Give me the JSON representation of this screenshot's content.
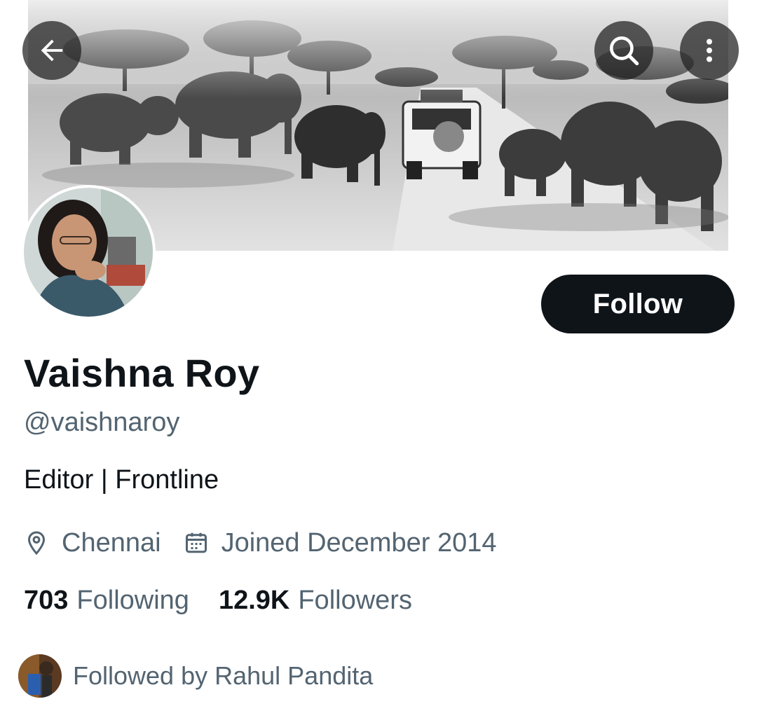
{
  "header": {
    "back_icon": "arrow-left-icon",
    "search_icon": "search-icon",
    "more_icon": "more-vertical-icon"
  },
  "profile": {
    "name": "Vaishna Roy",
    "handle": "@vaishnaroy",
    "bio": "Editor | Frontline",
    "location": "Chennai",
    "joined": "Joined December 2014",
    "follow_label": "Follow",
    "following_count": "703",
    "following_label": "Following",
    "followers_count": "12.9K",
    "followers_label": "Followers",
    "followed_by": "Followed by Rahul Pandita"
  },
  "colors": {
    "primary_text": "#0f1419",
    "secondary_text": "#536471",
    "follow_button_bg": "#0f1419"
  }
}
